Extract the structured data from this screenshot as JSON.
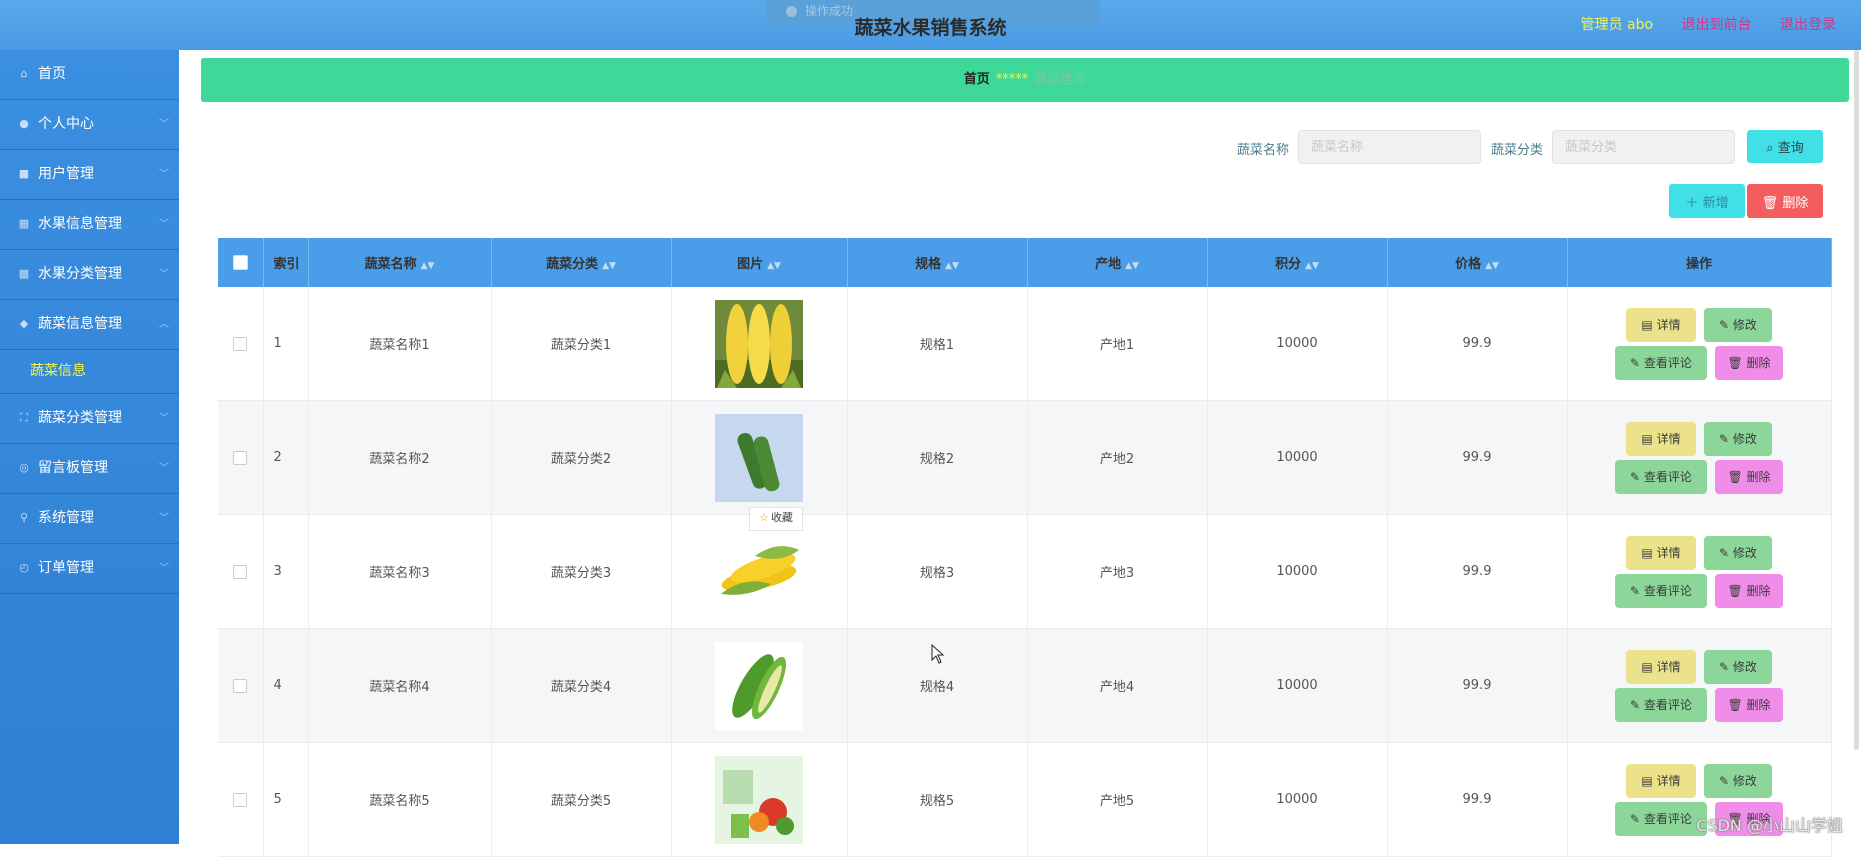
{
  "header": {
    "title": "蔬菜水果销售系统",
    "toast_text": "操作成功",
    "admin_label": "管理员 abo",
    "links": [
      "退出到前台",
      "退出登录"
    ]
  },
  "sidebar": {
    "items": [
      {
        "label": "首页",
        "icon": "home-icon"
      },
      {
        "label": "个人中心",
        "icon": "user-icon"
      },
      {
        "label": "用户管理",
        "icon": "users-icon"
      },
      {
        "label": "水果信息管理",
        "icon": "grid-icon"
      },
      {
        "label": "水果分类管理",
        "icon": "apps-icon"
      },
      {
        "label": "蔬菜信息管理",
        "icon": "leaf-icon",
        "expanded": true
      },
      {
        "label": "蔬菜分类管理",
        "icon": "category-icon"
      },
      {
        "label": "留言板管理",
        "icon": "message-icon"
      },
      {
        "label": "系统管理",
        "icon": "settings-icon"
      },
      {
        "label": "订单管理",
        "icon": "order-icon"
      }
    ],
    "active_subitem": "蔬菜信息"
  },
  "breadcrumb": {
    "home": "首页",
    "separator": "*****",
    "current": "蔬菜信息"
  },
  "search": {
    "name_label": "蔬菜名称",
    "name_placeholder": "蔬菜名称",
    "category_label": "蔬菜分类",
    "category_placeholder": "蔬菜分类",
    "query_button": "查询"
  },
  "actions": {
    "add": "新增",
    "delete": "删除"
  },
  "table": {
    "headers": [
      "索引",
      "蔬菜名称",
      "蔬菜分类",
      "图片",
      "规格",
      "产地",
      "积分",
      "价格",
      "操作"
    ],
    "rows": [
      {
        "index": "1",
        "name": "蔬菜名称1",
        "category": "蔬菜分类1",
        "spec": "规格1",
        "origin": "产地1",
        "points": "10000",
        "price": "99.9"
      },
      {
        "index": "2",
        "name": "蔬菜名称2",
        "category": "蔬菜分类2",
        "spec": "规格2",
        "origin": "产地2",
        "points": "10000",
        "price": "99.9"
      },
      {
        "index": "3",
        "name": "蔬菜名称3",
        "category": "蔬菜分类3",
        "spec": "规格3",
        "origin": "产地3",
        "points": "10000",
        "price": "99.9"
      },
      {
        "index": "4",
        "name": "蔬菜名称4",
        "category": "蔬菜分类4",
        "spec": "规格4",
        "origin": "产地4",
        "points": "10000",
        "price": "99.9"
      },
      {
        "index": "5",
        "name": "蔬菜名称5",
        "category": "蔬菜分类5",
        "spec": "规格5",
        "origin": "产地5",
        "points": "10000",
        "price": "99.9"
      }
    ],
    "row_actions": {
      "detail": "详情",
      "edit": "修改",
      "comments": "查看评论",
      "delete": "删除"
    }
  },
  "favorite_tag": "收藏",
  "watermark": "CSDN @小山山学姐",
  "colors": {
    "header": "#4a9ae4",
    "sidebar": "#3381d4",
    "breadcrumb": "#3ed898",
    "accent": "#41e0e6",
    "danger": "#f45d5d"
  }
}
